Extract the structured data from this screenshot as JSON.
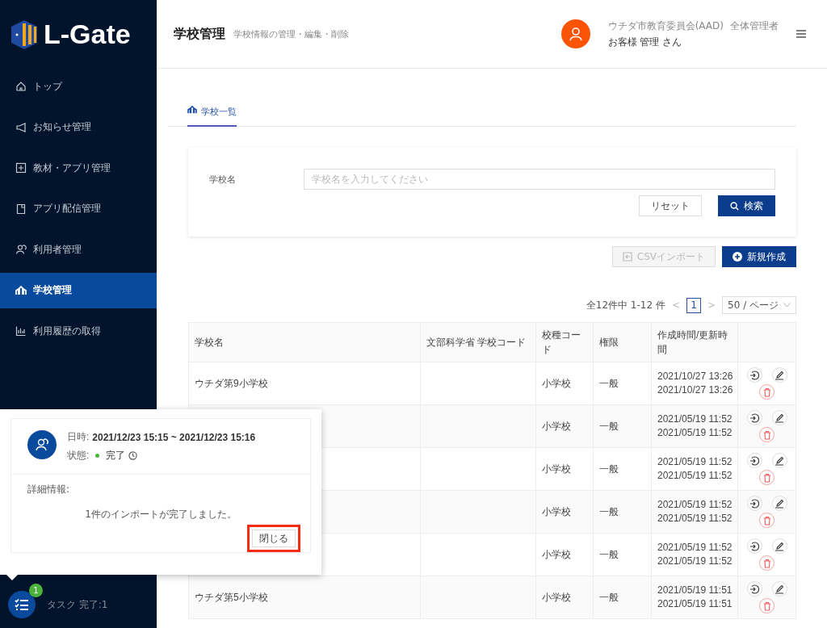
{
  "sidebar": {
    "logo": "L-Gate",
    "items": [
      {
        "label": "トップ",
        "selected": false
      },
      {
        "label": "お知らせ管理",
        "selected": false
      },
      {
        "label": "教材・アプリ管理",
        "selected": false
      },
      {
        "label": "アプリ配信管理",
        "selected": false
      },
      {
        "label": "利用者管理",
        "selected": false
      },
      {
        "label": "学校管理",
        "selected": true
      },
      {
        "label": "利用履歴の取得",
        "selected": false
      }
    ],
    "task": {
      "badge": "1",
      "label": "タスク 完了:1"
    }
  },
  "header": {
    "title": "学校管理",
    "subtitle": "学校情報の管理・編集・削除",
    "org": "ウチダ市教育委員会(AAD)",
    "role": "全体管理者",
    "user": "お客様 管理 さん"
  },
  "tabs": [
    {
      "label": "学校一覧",
      "selected": true
    }
  ],
  "search": {
    "label": "学校名",
    "placeholder": "学校名を入力してください",
    "reset": "リセット",
    "submit": "検索"
  },
  "actions": [
    {
      "label": "CSVインポート",
      "kind": "import",
      "disabled": true
    },
    {
      "label": "新規作成",
      "kind": "create",
      "disabled": false
    }
  ],
  "pagination": {
    "summary": "全12件中 1-12 件",
    "prev": "<",
    "page": "1",
    "next": ">",
    "page_size": "50 / ページ"
  },
  "table": {
    "columns": [
      "学校名",
      "文部科学省 学校コード",
      "校種コード",
      "権限",
      "作成時間/更新時間"
    ],
    "rows": [
      {
        "name": "ウチダ第9小学校",
        "type": "小学校",
        "role": "一般",
        "created": "2021/10/27 13:26",
        "updated": "2021/10/27 13:26"
      },
      {
        "type": "小学校",
        "role": "一般",
        "created": "2021/05/19 11:52",
        "updated": "2021/05/19 11:52"
      },
      {
        "type": "小学校",
        "role": "一般",
        "created": "2021/05/19 11:52",
        "updated": "2021/05/19 11:52"
      },
      {
        "type": "小学校",
        "role": "一般",
        "created": "2021/05/19 11:52",
        "updated": "2021/05/19 11:52"
      },
      {
        "type": "小学校",
        "role": "一般",
        "created": "2021/05/19 11:52",
        "updated": "2021/05/19 11:52"
      },
      {
        "name": "ウチダ第5小学校",
        "type": "小学校",
        "role": "一般",
        "created": "2021/05/19 11:51",
        "updated": "2021/05/19 11:51"
      }
    ]
  },
  "popup": {
    "datetime_label": "日時:",
    "datetime": "2021/12/23 15:15 ~ 2021/12/23 15:16",
    "status_label": "状態:",
    "status": "完了",
    "detail_label": "詳細情報:",
    "message": "1件のインポートが完了しました。",
    "close": "閉じる",
    "highlighted": true
  }
}
